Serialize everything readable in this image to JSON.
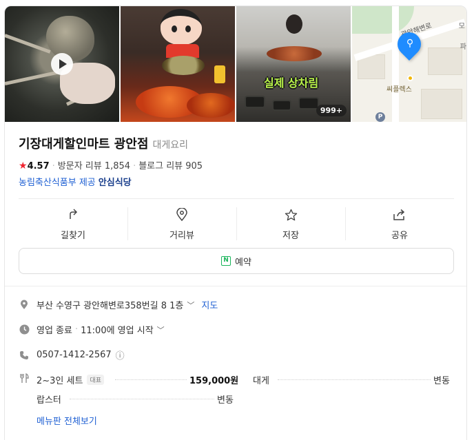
{
  "photos": {
    "overlay_caption": "실제 상차림",
    "photo_count": "999+",
    "map": {
      "road_label": "광안해변로",
      "top_label": "모",
      "side_label": "파",
      "place_label": "씨플렉스",
      "parking_label": "P"
    }
  },
  "place": {
    "name": "기장대게할인마트 광안점",
    "category": "대게요리",
    "rating": "4.57",
    "visitor_reviews": "방문자 리뷰 1,854",
    "blog_reviews": "블로그 리뷰 905",
    "source": "농림축산식품부 제공",
    "safe_badge": "안심식당"
  },
  "actions": [
    {
      "label": "길찾기",
      "icon": "directions-icon"
    },
    {
      "label": "거리뷰",
      "icon": "location-pin-icon"
    },
    {
      "label": "저장",
      "icon": "star-icon"
    },
    {
      "label": "공유",
      "icon": "share-icon"
    }
  ],
  "reserve": {
    "label": "예약",
    "badge": "N"
  },
  "info": {
    "address": "부산 수영구 광안해변로358번길 8 1층",
    "map_link": "지도",
    "hours_status": "영업 종료",
    "hours_next": "11:00에 영업 시작",
    "phone": "0507-1412-2567"
  },
  "menu": {
    "items": [
      {
        "name": "2~3인 세트",
        "tag": "대표",
        "price": "159,000원"
      },
      {
        "name": "대게",
        "price": "변동"
      },
      {
        "name": "랍스터",
        "price": "변동"
      }
    ],
    "view_all": "메뉴판 전체보기"
  },
  "colors": {
    "accent_blue": "#1e5fd3",
    "star_red": "#f0242f",
    "naver_green": "#19b45a",
    "pin_blue": "#1f8cff",
    "overlay_green": "#b8f249"
  }
}
